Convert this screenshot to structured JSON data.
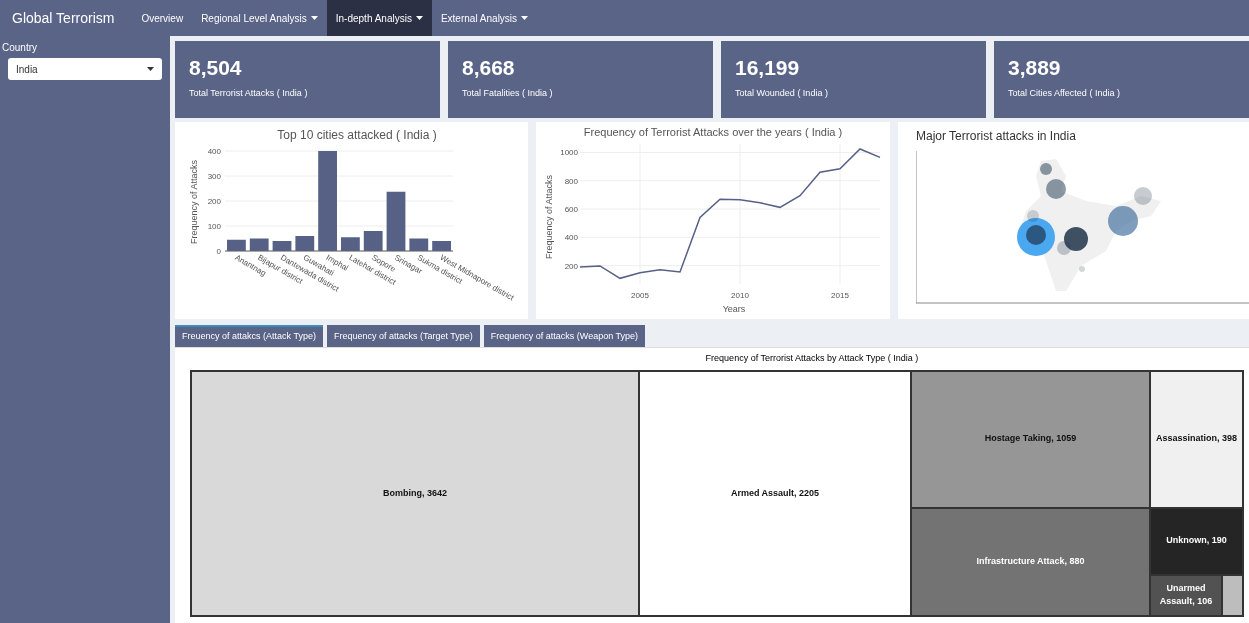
{
  "navbar": {
    "brand": "Global Terrorism",
    "items": [
      {
        "label": "Overview",
        "selected": false,
        "dropdown": false
      },
      {
        "label": "Regional Level Analysis",
        "selected": false,
        "dropdown": true
      },
      {
        "label": "In-depth Analysis",
        "selected": true,
        "dropdown": true
      },
      {
        "label": "External Analysis",
        "selected": false,
        "dropdown": true
      }
    ]
  },
  "sidebar": {
    "label": "Country",
    "select": {
      "value": "India"
    }
  },
  "kpis": [
    {
      "value": "8,504",
      "label": "Total Terrorist Attacks ( India )"
    },
    {
      "value": "8,668",
      "label": "Total Fatalities ( India )"
    },
    {
      "value": "16,199",
      "label": "Total Wounded ( India )"
    },
    {
      "value": "3,889",
      "label": "Total Cities Affected ( India )"
    }
  ],
  "bar_panel": {
    "chart_data": {
      "type": "bar",
      "title": "Top 10 cities attacked ( India )",
      "ylabel": "Frequency of Attacks",
      "categories": [
        "Anantnag",
        "Bijapur district",
        "Dantewada district",
        "Guwahati",
        "Imphal",
        "Latehar district",
        "Sopore",
        "Srinagar",
        "Sukma district",
        "West Midnapore district"
      ],
      "series": [
        {
          "color": "#566185",
          "values": [
            45,
            50,
            40,
            60,
            400,
            55,
            80,
            237,
            50,
            40
          ]
        }
      ],
      "ylim": [
        0,
        400
      ],
      "yticks": [
        0,
        100,
        200,
        300,
        400
      ],
      "grid": true
    }
  },
  "line_panel": {
    "chart_data": {
      "type": "line",
      "title": "Frequency of Terrorist Attacks over the years ( India )",
      "xlabel": "Years",
      "ylabel": "Frequency of Attacks",
      "x": [
        2002,
        2003,
        2004,
        2005,
        2006,
        2007,
        2008,
        2009,
        2010,
        2011,
        2012,
        2013,
        2014,
        2015,
        2016,
        2017
      ],
      "series": [
        {
          "color": "#566185",
          "values": [
            190,
            198,
            110,
            150,
            170,
            155,
            540,
            670,
            665,
            645,
            612,
            695,
            860,
            885,
            1025,
            965
          ]
        }
      ],
      "xlim": [
        2002,
        2017
      ],
      "ylim": [
        70,
        1060
      ],
      "xticks": [
        2005,
        2010,
        2015
      ],
      "yticks": [
        200,
        400,
        600,
        800,
        1000
      ],
      "grid": true
    }
  },
  "map_panel": {
    "title": "Major Terrorist attacks in India"
  },
  "tabs": [
    {
      "label": "Freuency of attakcs (Attack Type)",
      "selected": true
    },
    {
      "label": "Frequency of attacks (Target Type)",
      "selected": false
    },
    {
      "label": "Frequency of attacks (Weapon Type)",
      "selected": false
    }
  ],
  "treemap": {
    "title": "Frequency of Terrorist Attacks by Attack Type ( India )",
    "tiles": [
      {
        "label": "Bombing, 3642",
        "color": "#d9d9d9"
      },
      {
        "label": "Armed Assault, 2205",
        "color": "#ffffff"
      },
      {
        "label": "Hostage Taking, 1059",
        "color": "#969696"
      },
      {
        "label": "Assassination, 398",
        "color": "#f0f0f0"
      },
      {
        "label": "Infrastructure Attack, 880",
        "color": "#737373"
      },
      {
        "label": "Unknown, 190",
        "color": "#252525"
      },
      {
        "label": "Unarmed Assault, 106",
        "color": "#525252"
      },
      {
        "color": "#bdbdbd"
      }
    ]
  }
}
